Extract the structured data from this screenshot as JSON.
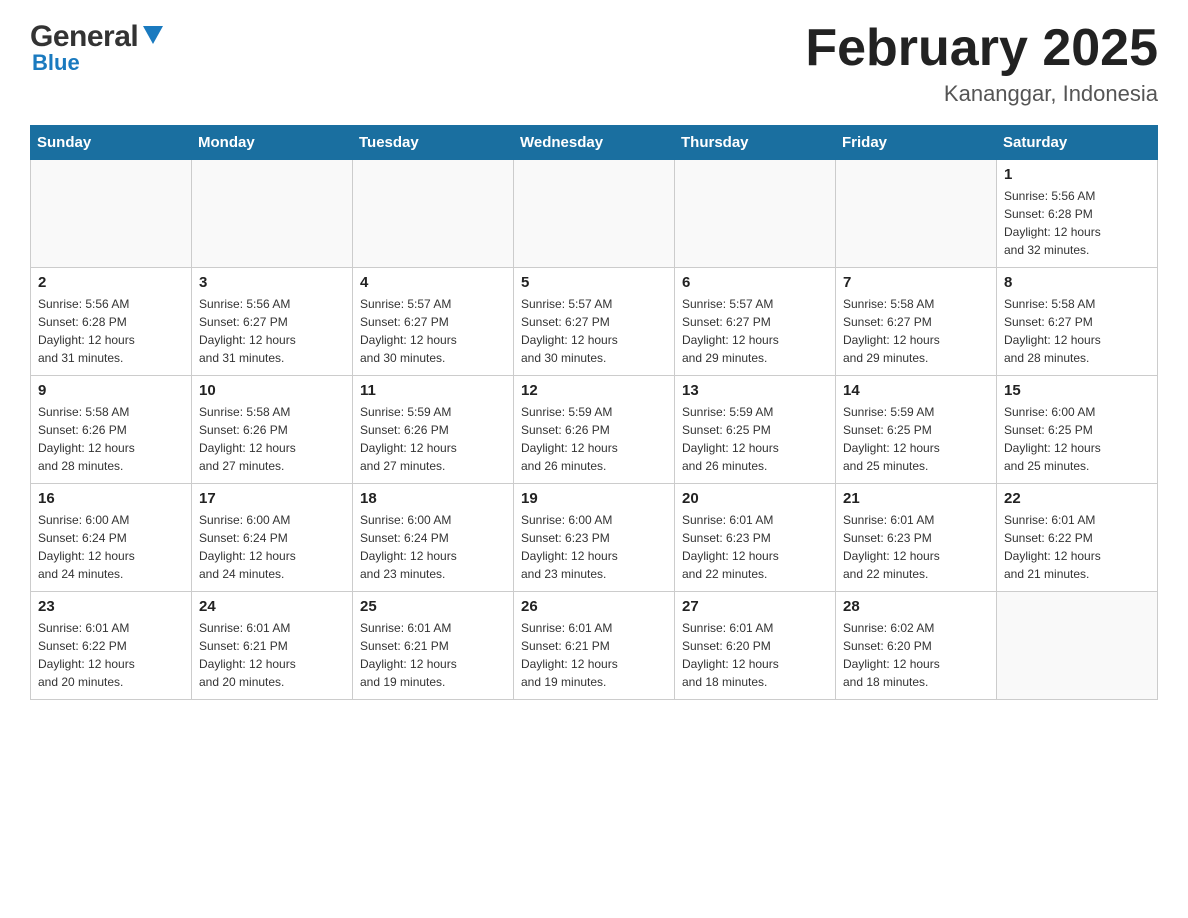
{
  "header": {
    "logo_general": "General",
    "logo_blue": "Blue",
    "month_title": "February 2025",
    "location": "Kananggar, Indonesia"
  },
  "days_of_week": [
    "Sunday",
    "Monday",
    "Tuesday",
    "Wednesday",
    "Thursday",
    "Friday",
    "Saturday"
  ],
  "weeks": [
    [
      {
        "day": "",
        "info": ""
      },
      {
        "day": "",
        "info": ""
      },
      {
        "day": "",
        "info": ""
      },
      {
        "day": "",
        "info": ""
      },
      {
        "day": "",
        "info": ""
      },
      {
        "day": "",
        "info": ""
      },
      {
        "day": "1",
        "info": "Sunrise: 5:56 AM\nSunset: 6:28 PM\nDaylight: 12 hours\nand 32 minutes."
      }
    ],
    [
      {
        "day": "2",
        "info": "Sunrise: 5:56 AM\nSunset: 6:28 PM\nDaylight: 12 hours\nand 31 minutes."
      },
      {
        "day": "3",
        "info": "Sunrise: 5:56 AM\nSunset: 6:27 PM\nDaylight: 12 hours\nand 31 minutes."
      },
      {
        "day": "4",
        "info": "Sunrise: 5:57 AM\nSunset: 6:27 PM\nDaylight: 12 hours\nand 30 minutes."
      },
      {
        "day": "5",
        "info": "Sunrise: 5:57 AM\nSunset: 6:27 PM\nDaylight: 12 hours\nand 30 minutes."
      },
      {
        "day": "6",
        "info": "Sunrise: 5:57 AM\nSunset: 6:27 PM\nDaylight: 12 hours\nand 29 minutes."
      },
      {
        "day": "7",
        "info": "Sunrise: 5:58 AM\nSunset: 6:27 PM\nDaylight: 12 hours\nand 29 minutes."
      },
      {
        "day": "8",
        "info": "Sunrise: 5:58 AM\nSunset: 6:27 PM\nDaylight: 12 hours\nand 28 minutes."
      }
    ],
    [
      {
        "day": "9",
        "info": "Sunrise: 5:58 AM\nSunset: 6:26 PM\nDaylight: 12 hours\nand 28 minutes."
      },
      {
        "day": "10",
        "info": "Sunrise: 5:58 AM\nSunset: 6:26 PM\nDaylight: 12 hours\nand 27 minutes."
      },
      {
        "day": "11",
        "info": "Sunrise: 5:59 AM\nSunset: 6:26 PM\nDaylight: 12 hours\nand 27 minutes."
      },
      {
        "day": "12",
        "info": "Sunrise: 5:59 AM\nSunset: 6:26 PM\nDaylight: 12 hours\nand 26 minutes."
      },
      {
        "day": "13",
        "info": "Sunrise: 5:59 AM\nSunset: 6:25 PM\nDaylight: 12 hours\nand 26 minutes."
      },
      {
        "day": "14",
        "info": "Sunrise: 5:59 AM\nSunset: 6:25 PM\nDaylight: 12 hours\nand 25 minutes."
      },
      {
        "day": "15",
        "info": "Sunrise: 6:00 AM\nSunset: 6:25 PM\nDaylight: 12 hours\nand 25 minutes."
      }
    ],
    [
      {
        "day": "16",
        "info": "Sunrise: 6:00 AM\nSunset: 6:24 PM\nDaylight: 12 hours\nand 24 minutes."
      },
      {
        "day": "17",
        "info": "Sunrise: 6:00 AM\nSunset: 6:24 PM\nDaylight: 12 hours\nand 24 minutes."
      },
      {
        "day": "18",
        "info": "Sunrise: 6:00 AM\nSunset: 6:24 PM\nDaylight: 12 hours\nand 23 minutes."
      },
      {
        "day": "19",
        "info": "Sunrise: 6:00 AM\nSunset: 6:23 PM\nDaylight: 12 hours\nand 23 minutes."
      },
      {
        "day": "20",
        "info": "Sunrise: 6:01 AM\nSunset: 6:23 PM\nDaylight: 12 hours\nand 22 minutes."
      },
      {
        "day": "21",
        "info": "Sunrise: 6:01 AM\nSunset: 6:23 PM\nDaylight: 12 hours\nand 22 minutes."
      },
      {
        "day": "22",
        "info": "Sunrise: 6:01 AM\nSunset: 6:22 PM\nDaylight: 12 hours\nand 21 minutes."
      }
    ],
    [
      {
        "day": "23",
        "info": "Sunrise: 6:01 AM\nSunset: 6:22 PM\nDaylight: 12 hours\nand 20 minutes."
      },
      {
        "day": "24",
        "info": "Sunrise: 6:01 AM\nSunset: 6:21 PM\nDaylight: 12 hours\nand 20 minutes."
      },
      {
        "day": "25",
        "info": "Sunrise: 6:01 AM\nSunset: 6:21 PM\nDaylight: 12 hours\nand 19 minutes."
      },
      {
        "day": "26",
        "info": "Sunrise: 6:01 AM\nSunset: 6:21 PM\nDaylight: 12 hours\nand 19 minutes."
      },
      {
        "day": "27",
        "info": "Sunrise: 6:01 AM\nSunset: 6:20 PM\nDaylight: 12 hours\nand 18 minutes."
      },
      {
        "day": "28",
        "info": "Sunrise: 6:02 AM\nSunset: 6:20 PM\nDaylight: 12 hours\nand 18 minutes."
      },
      {
        "day": "",
        "info": ""
      }
    ]
  ]
}
